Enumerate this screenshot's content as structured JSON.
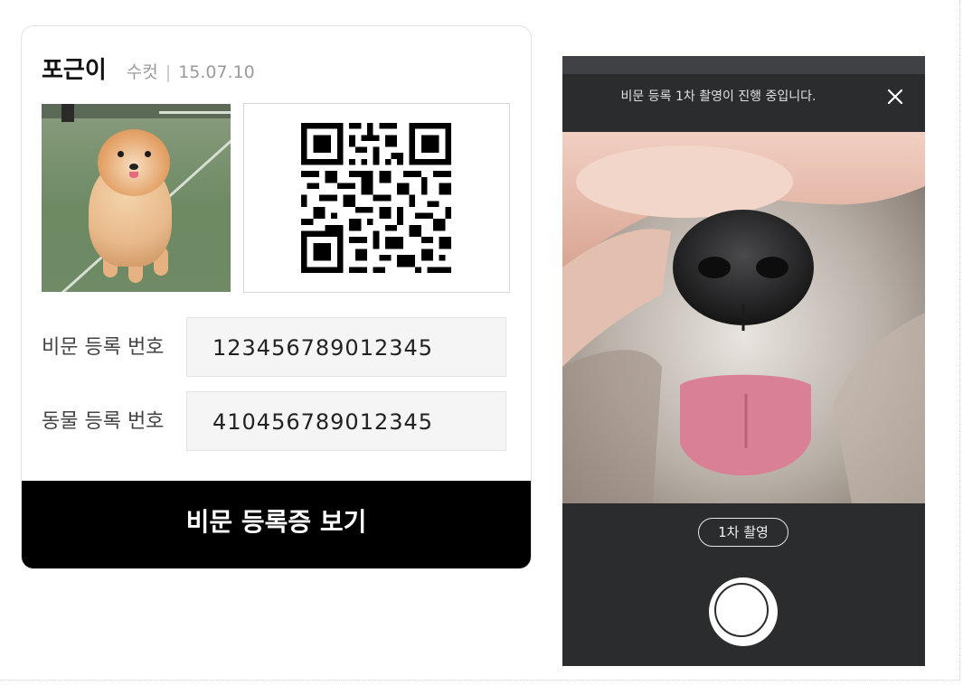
{
  "card": {
    "pet_name": "포근이",
    "gender": "수컷",
    "separator": "|",
    "birth_date": "15.07.10",
    "rows": [
      {
        "label": "비문 등록 번호",
        "value": "123456789012345"
      },
      {
        "label": "동물 등록 번호",
        "value": "410456789012345"
      }
    ],
    "view_button": "비문 등록증 보기"
  },
  "camera": {
    "status_text": "비문 등록 1차 촬영이 진행 중입니다.",
    "step_badge": "1차 촬영"
  },
  "colors": {
    "button_bg": "#000000",
    "camera_bg": "#2b2c2e",
    "value_field_bg": "#f5f5f5"
  },
  "icons": {
    "close": "close-icon",
    "shutter": "shutter-button"
  }
}
